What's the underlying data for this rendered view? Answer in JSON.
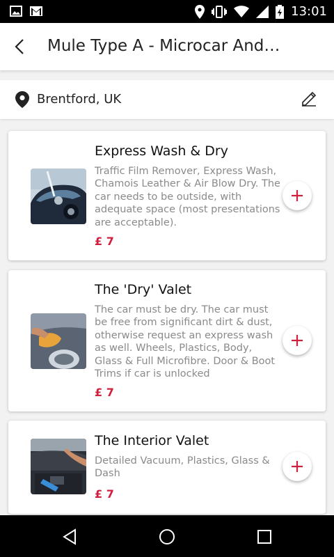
{
  "status_bar": {
    "time": "13:01"
  },
  "header": {
    "title": "Mule Type A - Microcar And…"
  },
  "location": {
    "text": "Brentford, UK"
  },
  "services": [
    {
      "title": "Express Wash & Dry",
      "description": "Traffic Film Remover, Express Wash, Chamois Leather & Air Blow Dry. The car needs to be outside, with adequate space (most presentations are acceptable).",
      "price": "£ 7"
    },
    {
      "title": "The 'Dry' Valet",
      "description": "The car must be dry. The car must be free from significant dirt & dust, otherwise request an express wash as well. Wheels, Plastics, Body, Glass & Full Microfibre. Door & Boot Trims if car is unlocked",
      "price": "£ 7"
    },
    {
      "title": "The Interior Valet",
      "description": "Detailed Vacuum, Plastics, Glass & Dash",
      "price": "£ 7"
    }
  ],
  "colors": {
    "accent": "#d11f3f",
    "status_bar": "#000000",
    "nav_bar": "#000000"
  }
}
